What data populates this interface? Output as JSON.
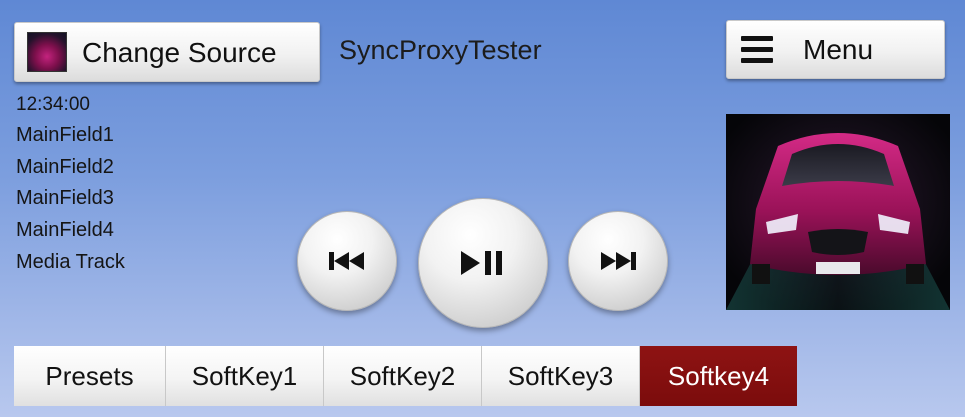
{
  "header": {
    "change_source_label": "Change Source",
    "app_title": "SyncProxyTester",
    "menu_label": "Menu"
  },
  "info": {
    "clock": "12:34:00",
    "main_field_1": "MainField1",
    "main_field_2": "MainField2",
    "main_field_3": "MainField3",
    "main_field_4": "MainField4",
    "media_track": "Media Track"
  },
  "media_controls": {
    "prev_icon": "skip-previous-icon",
    "play_pause_icon": "play-pause-icon",
    "next_icon": "skip-next-icon"
  },
  "softkeys": [
    {
      "label": "Presets",
      "active": false
    },
    {
      "label": "SoftKey1",
      "active": false
    },
    {
      "label": "SoftKey2",
      "active": false
    },
    {
      "label": "SoftKey3",
      "active": false
    },
    {
      "label": "Softkey4",
      "active": true
    }
  ],
  "colors": {
    "background_top": "#5f88d4",
    "background_bottom": "#b8c8ee",
    "softkey_active": "#7b0c0c"
  }
}
